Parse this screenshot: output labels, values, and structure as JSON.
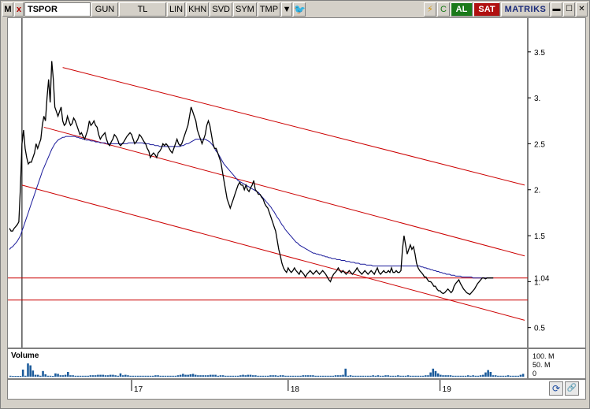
{
  "toolbar": {
    "m_label": "M",
    "close_label": "x",
    "symbol": "TSPOR",
    "period": "GUN",
    "currency": "TL",
    "scale": "LIN",
    "khn": "KHN",
    "svd": "SVD",
    "sym": "SYM",
    "tmp": "TMP",
    "buy_label": "AL",
    "sell_label": "SAT",
    "brand": "MATRIKS",
    "icons": [
      "dropdown-icon",
      "twitter-icon",
      "lightning-icon",
      "refresh-icon",
      "minimize-icon",
      "maximize-icon",
      "close-icon"
    ]
  },
  "volume": {
    "label": "Volume",
    "ticks": [
      "100. M",
      "50. M",
      "0"
    ],
    "bars": [
      2,
      1,
      1,
      1,
      1,
      15,
      2,
      28,
      24,
      13,
      4,
      4,
      2,
      12,
      5,
      2,
      2,
      1,
      7,
      6,
      3,
      3,
      4,
      10,
      3,
      3,
      2,
      2,
      2,
      2,
      2,
      2,
      3,
      3,
      3,
      4,
      4,
      4,
      3,
      3,
      4,
      4,
      3,
      2,
      7,
      3,
      4,
      3,
      2,
      2,
      2,
      2,
      2,
      2,
      2,
      2,
      2,
      2,
      3,
      3,
      2,
      2,
      2,
      2,
      2,
      2,
      2,
      3,
      4,
      6,
      4,
      4,
      5,
      6,
      4,
      3,
      3,
      3,
      3,
      3,
      4,
      4,
      4,
      2,
      3,
      3,
      2,
      2,
      2,
      2,
      2,
      2,
      3,
      4,
      3,
      4,
      4,
      3,
      3,
      2,
      2,
      2,
      2,
      2,
      3,
      3,
      3,
      2,
      3,
      3,
      2,
      2,
      2,
      2,
      2,
      2,
      2,
      3,
      3,
      3,
      3,
      3,
      2,
      2,
      2,
      2,
      2,
      2,
      2,
      2,
      3,
      3,
      3,
      4,
      17,
      2,
      3,
      2,
      2,
      2,
      2,
      2,
      2,
      2,
      2,
      3,
      2,
      3,
      2,
      2,
      3,
      3,
      2,
      2,
      2,
      3,
      2,
      2,
      2,
      3,
      2,
      2,
      2,
      2,
      2,
      2,
      3,
      3,
      9,
      17,
      12,
      7,
      4,
      3,
      3,
      3,
      3,
      2,
      2,
      2,
      2,
      2,
      2,
      3,
      2,
      3,
      2,
      2,
      3,
      4,
      9,
      14,
      10,
      3,
      3,
      2,
      2,
      2,
      2,
      3,
      2,
      2,
      2,
      2,
      4,
      6
    ]
  },
  "chart_data": {
    "type": "line",
    "ylim": [
      0.3,
      3.85
    ],
    "yticks": [
      3.5,
      3.0,
      2.5,
      2.0,
      1.5,
      1.0,
      0.5
    ],
    "ytick_labels": [
      "3.5",
      "3.",
      "2.5",
      "2.",
      "1.5",
      "1.",
      "0.5"
    ],
    "last_price_label": "1.04",
    "xtick_labels": [
      "17",
      "18",
      "19"
    ],
    "xtick_index": [
      78,
      178,
      275
    ],
    "n": 330,
    "price": [
      1.58,
      1.55,
      1.55,
      1.58,
      1.6,
      1.62,
      1.65,
      2.02,
      2.5,
      2.65,
      2.45,
      2.35,
      2.28,
      2.3,
      2.3,
      2.35,
      2.4,
      2.5,
      2.45,
      2.5,
      2.55,
      2.7,
      2.8,
      2.75,
      3.0,
      3.2,
      2.95,
      3.4,
      3.2,
      2.9,
      2.85,
      2.8,
      2.85,
      2.9,
      2.75,
      2.7,
      2.72,
      2.8,
      2.75,
      2.7,
      2.72,
      2.78,
      2.75,
      2.7,
      2.65,
      2.6,
      2.62,
      2.58,
      2.55,
      2.6,
      2.65,
      2.75,
      2.7,
      2.72,
      2.75,
      2.7,
      2.68,
      2.6,
      2.55,
      2.58,
      2.6,
      2.62,
      2.55,
      2.5,
      2.48,
      2.52,
      2.55,
      2.6,
      2.58,
      2.55,
      2.5,
      2.48,
      2.5,
      2.52,
      2.55,
      2.58,
      2.6,
      2.62,
      2.6,
      2.55,
      2.5,
      2.52,
      2.55,
      2.6,
      2.58,
      2.55,
      2.52,
      2.5,
      2.45,
      2.42,
      2.35,
      2.38,
      2.4,
      2.38,
      2.35,
      2.4,
      2.42,
      2.45,
      2.5,
      2.48,
      2.5,
      2.48,
      2.45,
      2.42,
      2.4,
      2.45,
      2.5,
      2.55,
      2.5,
      2.48,
      2.5,
      2.55,
      2.6,
      2.65,
      2.7,
      2.8,
      2.9,
      2.85,
      2.8,
      2.75,
      2.65,
      2.6,
      2.55,
      2.5,
      2.55,
      2.6,
      2.7,
      2.75,
      2.7,
      2.6,
      2.5,
      2.45,
      2.45,
      2.4,
      2.35,
      2.3,
      2.2,
      2.1,
      2.0,
      1.9,
      1.85,
      1.8,
      1.85,
      1.9,
      1.95,
      2.0,
      2.05,
      2.08,
      2.05,
      2.05,
      2.0,
      2.05,
      2.0,
      1.98,
      2.02,
      2.05,
      2.1,
      2.0,
      1.98,
      1.95,
      1.95,
      1.92,
      1.9,
      1.85,
      1.82,
      1.8,
      1.75,
      1.7,
      1.65,
      1.6,
      1.55,
      1.45,
      1.35,
      1.28,
      1.2,
      1.15,
      1.12,
      1.1,
      1.15,
      1.12,
      1.1,
      1.12,
      1.15,
      1.12,
      1.1,
      1.08,
      1.12,
      1.1,
      1.08,
      1.05,
      1.08,
      1.1,
      1.12,
      1.1,
      1.08,
      1.1,
      1.12,
      1.1,
      1.08,
      1.1,
      1.12,
      1.1,
      1.08,
      1.05,
      1.02,
      1.0,
      1.05,
      1.08,
      1.1,
      1.12,
      1.15,
      1.12,
      1.1,
      1.12,
      1.1,
      1.08,
      1.1,
      1.12,
      1.1,
      1.08,
      1.1,
      1.12,
      1.15,
      1.12,
      1.1,
      1.08,
      1.1,
      1.12,
      1.1,
      1.08,
      1.1,
      1.12,
      1.1,
      1.08,
      1.12,
      1.15,
      1.1,
      1.08,
      1.1,
      1.12,
      1.1,
      1.1,
      1.12,
      1.1,
      1.15,
      1.1,
      1.1,
      1.12,
      1.1,
      1.1,
      1.12,
      1.35,
      1.5,
      1.4,
      1.3,
      1.35,
      1.4,
      1.35,
      1.38,
      1.3,
      1.2,
      1.15,
      1.12,
      1.1,
      1.08,
      1.05,
      1.05,
      1.02,
      1.0,
      1.0,
      0.98,
      0.95,
      0.95,
      0.92,
      0.9,
      0.9,
      0.88,
      0.87,
      0.88,
      0.9,
      0.92,
      0.9,
      0.88,
      0.9,
      0.95,
      0.98,
      1.0,
      1.02,
      0.98,
      0.95,
      0.92,
      0.9,
      0.88,
      0.87,
      0.86,
      0.88,
      0.9,
      0.92,
      0.95,
      0.98,
      1.0,
      1.02,
      1.04,
      1.04,
      1.03,
      1.04,
      1.04,
      1.04,
      1.04,
      1.04
    ],
    "ma": [
      1.35,
      1.37,
      1.38,
      1.4,
      1.42,
      1.44,
      1.47,
      1.5,
      1.55,
      1.6,
      1.65,
      1.7,
      1.75,
      1.8,
      1.85,
      1.9,
      1.95,
      2.0,
      2.05,
      2.1,
      2.15,
      2.2,
      2.24,
      2.28,
      2.32,
      2.36,
      2.4,
      2.44,
      2.47,
      2.5,
      2.52,
      2.54,
      2.55,
      2.56,
      2.57,
      2.57,
      2.58,
      2.58,
      2.58,
      2.58,
      2.58,
      2.58,
      2.58,
      2.57,
      2.57,
      2.56,
      2.56,
      2.55,
      2.55,
      2.54,
      2.54,
      2.54,
      2.53,
      2.53,
      2.53,
      2.52,
      2.52,
      2.52,
      2.51,
      2.51,
      2.51,
      2.51,
      2.5,
      2.5,
      2.5,
      2.5,
      2.5,
      2.5,
      2.5,
      2.5,
      2.5,
      2.5,
      2.5,
      2.5,
      2.5,
      2.5,
      2.51,
      2.51,
      2.51,
      2.51,
      2.51,
      2.51,
      2.51,
      2.51,
      2.51,
      2.51,
      2.5,
      2.5,
      2.5,
      2.5,
      2.49,
      2.49,
      2.49,
      2.48,
      2.48,
      2.48,
      2.47,
      2.47,
      2.47,
      2.47,
      2.47,
      2.47,
      2.47,
      2.47,
      2.47,
      2.47,
      2.47,
      2.47,
      2.47,
      2.47,
      2.48,
      2.48,
      2.49,
      2.5,
      2.5,
      2.51,
      2.52,
      2.53,
      2.54,
      2.55,
      2.55,
      2.55,
      2.55,
      2.55,
      2.55,
      2.55,
      2.54,
      2.53,
      2.52,
      2.5,
      2.48,
      2.45,
      2.42,
      2.4,
      2.37,
      2.34,
      2.31,
      2.28,
      2.26,
      2.24,
      2.22,
      2.2,
      2.18,
      2.16,
      2.14,
      2.12,
      2.1,
      2.09,
      2.08,
      2.07,
      2.06,
      2.05,
      2.04,
      2.03,
      2.02,
      2.01,
      2.0,
      1.99,
      1.98,
      1.97,
      1.95,
      1.93,
      1.91,
      1.89,
      1.87,
      1.85,
      1.83,
      1.81,
      1.78,
      1.76,
      1.73,
      1.7,
      1.68,
      1.65,
      1.62,
      1.6,
      1.57,
      1.55,
      1.53,
      1.51,
      1.49,
      1.47,
      1.45,
      1.43,
      1.42,
      1.4,
      1.39,
      1.38,
      1.37,
      1.36,
      1.35,
      1.34,
      1.33,
      1.32,
      1.31,
      1.31,
      1.3,
      1.3,
      1.29,
      1.29,
      1.28,
      1.28,
      1.27,
      1.27,
      1.26,
      1.26,
      1.25,
      1.25,
      1.25,
      1.24,
      1.24,
      1.24,
      1.23,
      1.23,
      1.23,
      1.22,
      1.22,
      1.22,
      1.21,
      1.21,
      1.21,
      1.2,
      1.2,
      1.2,
      1.19,
      1.19,
      1.19,
      1.19,
      1.18,
      1.18,
      1.18,
      1.18,
      1.17,
      1.17,
      1.17,
      1.17,
      1.17,
      1.17,
      1.17,
      1.17,
      1.17,
      1.17,
      1.17,
      1.17,
      1.17,
      1.17,
      1.17,
      1.17,
      1.17,
      1.17,
      1.17,
      1.17,
      1.17,
      1.17,
      1.17,
      1.17,
      1.17,
      1.17,
      1.17,
      1.17,
      1.17,
      1.17,
      1.17,
      1.16,
      1.16,
      1.15,
      1.15,
      1.14,
      1.14,
      1.13,
      1.13,
      1.12,
      1.12,
      1.11,
      1.11,
      1.1,
      1.1,
      1.09,
      1.09,
      1.08,
      1.08,
      1.08,
      1.07,
      1.07,
      1.07,
      1.06,
      1.06,
      1.06,
      1.06,
      1.05,
      1.05,
      1.05,
      1.05,
      1.05,
      1.05,
      1.05,
      1.04,
      1.04,
      1.04,
      1.04,
      1.04,
      1.04,
      1.04,
      1.04,
      1.04,
      1.04,
      1.04,
      1.04,
      1.04,
      1.04
    ],
    "channel_lines": [
      {
        "from": [
          34,
          3.33
        ],
        "to": [
          330,
          2.05
        ]
      },
      {
        "from": [
          22,
          2.68
        ],
        "to": [
          330,
          1.28
        ]
      },
      {
        "from": [
          8,
          2.05
        ],
        "to": [
          330,
          0.58
        ]
      }
    ],
    "horizontal_lines": [
      1.04,
      0.8
    ],
    "vertical_marker_index": 8,
    "colors": {
      "price": "#000000",
      "ma": "#1a1a9a",
      "channel": "#cc0000",
      "grid": "#d8d8d8"
    }
  }
}
